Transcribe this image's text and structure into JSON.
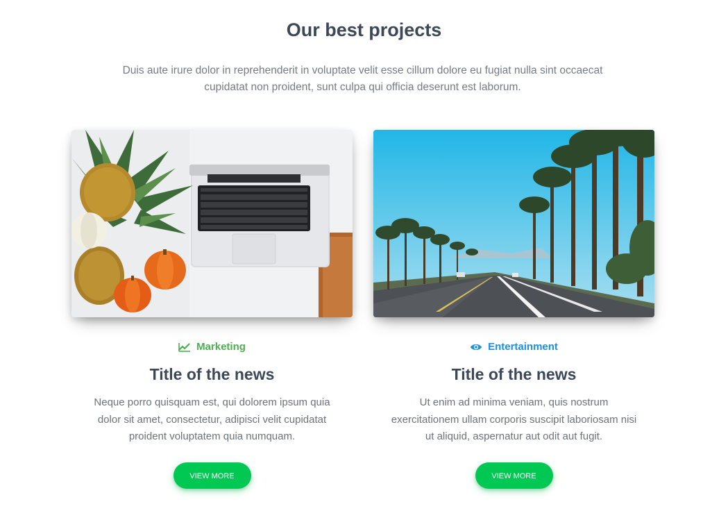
{
  "section": {
    "title": "Our best projects",
    "description": "Duis aute irure dolor in reprehenderit in voluptate velit esse cillum dolore eu fugiat nulla sint occaecat cupidatat non proident, sunt culpa qui officia deserunt est laborum."
  },
  "cards": [
    {
      "category": "Marketing",
      "category_icon": "trending-up-icon",
      "category_color": "#4caf50",
      "title": "Title of the news",
      "text": "Neque porro quisquam est, qui dolorem ipsum quia dolor sit amet, consectetur, adipisci velit cupidatat proident voluptatem quia numquam.",
      "button_label": "View More",
      "image": "laptop-with-pineapples-and-pumpkins"
    },
    {
      "category": "Entertainment",
      "category_icon": "eye-icon",
      "category_color": "#1a8fe3",
      "title": "Title of the news",
      "text": "Ut enim ad minima veniam, quis nostrum exercitationem ullam corporis suscipit laboriosam nisi ut aliquid, aspernatur aut odit aut fugit.",
      "button_label": "View More",
      "image": "palm-tree-lined-road"
    }
  ],
  "colors": {
    "button": "#00c853",
    "heading": "#3c4858",
    "body_text": "#6c727b"
  }
}
